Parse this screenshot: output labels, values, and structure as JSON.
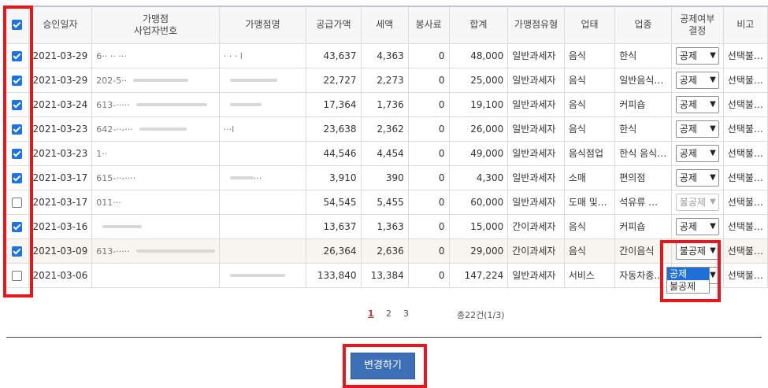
{
  "table": {
    "headers": {
      "approval_date": "승인일자",
      "merchant_bizno": "가맹점\n사업자번호",
      "merchant_name": "가맹점명",
      "supply_amount": "공급가액",
      "tax": "세액",
      "service_fee": "봉사료",
      "total": "합계",
      "merchant_type": "가맹점유형",
      "business_type": "업태",
      "business_item": "업종",
      "deduction": "공제여부\n결정",
      "note": "비고"
    },
    "rows": [
      {
        "checked": true,
        "date": "2021-03-29",
        "bizno": "6·· ·· ···",
        "name": "· · · l",
        "supply": "43,637",
        "tax": "4,363",
        "fee": "0",
        "total": "48,000",
        "type": "일반과세자",
        "biz": "음식",
        "item": "한식",
        "deduct": "공제",
        "deduct_disabled": false,
        "note": "선택불…"
      },
      {
        "checked": true,
        "date": "2021-03-29",
        "bizno": "202-5··",
        "name": "",
        "supply": "22,727",
        "tax": "2,273",
        "fee": "0",
        "total": "25,000",
        "type": "일반과세자",
        "biz": "음식",
        "item": "일반음식…",
        "deduct": "공제",
        "deduct_disabled": false,
        "note": "선택불…"
      },
      {
        "checked": true,
        "date": "2021-03-24",
        "bizno": "613-·····",
        "name": "",
        "supply": "17,364",
        "tax": "1,736",
        "fee": "0",
        "total": "19,100",
        "type": "일반과세자",
        "biz": "음식",
        "item": "커피숍",
        "deduct": "공제",
        "deduct_disabled": false,
        "note": "선택불…"
      },
      {
        "checked": true,
        "date": "2021-03-23",
        "bizno": "642-··-···",
        "name": "···l",
        "supply": "23,638",
        "tax": "2,362",
        "fee": "0",
        "total": "26,000",
        "type": "일반과세자",
        "biz": "음식",
        "item": "한식",
        "deduct": "공제",
        "deduct_disabled": false,
        "note": "선택불…"
      },
      {
        "checked": true,
        "date": "2021-03-23",
        "bizno": "1··",
        "name": "",
        "supply": "44,546",
        "tax": "4,454",
        "fee": "0",
        "total": "49,000",
        "type": "일반과세자",
        "biz": "음식점업",
        "item": "한식 음식…",
        "deduct": "공제",
        "deduct_disabled": false,
        "note": "선택불…"
      },
      {
        "checked": true,
        "date": "2021-03-17",
        "bizno": "615-··-····",
        "name": "···",
        "supply": "3,910",
        "tax": "390",
        "fee": "0",
        "total": "4,300",
        "type": "일반과세자",
        "biz": "소매",
        "item": "편의점",
        "deduct": "공제",
        "deduct_disabled": false,
        "note": "선택불…"
      },
      {
        "checked": false,
        "date": "2021-03-17",
        "bizno": "011···",
        "name": "",
        "supply": "54,545",
        "tax": "5,455",
        "fee": "0",
        "total": "60,000",
        "type": "일반과세자",
        "biz": "도매  및…",
        "item": "석유류  …",
        "deduct": "불공제",
        "deduct_disabled": true,
        "note": "선택불…"
      },
      {
        "checked": true,
        "date": "2021-03-16",
        "bizno": "",
        "name": "",
        "supply": "13,637",
        "tax": "1,363",
        "fee": "0",
        "total": "15,000",
        "type": "간이과세자",
        "biz": "음식",
        "item": "커피숍",
        "deduct": "공제",
        "deduct_disabled": false,
        "note": "선택불…"
      },
      {
        "checked": true,
        "date": "2021-03-09",
        "bizno": "613-·····",
        "name": "",
        "supply": "26,364",
        "tax": "2,636",
        "fee": "0",
        "total": "29,000",
        "type": "간이과세자",
        "biz": "음식",
        "item": "간이음식",
        "deduct": "불공제",
        "deduct_disabled": false,
        "note": "선택불…"
      },
      {
        "checked": false,
        "date": "2021-03-06",
        "bizno": "",
        "name": "",
        "supply": "133,840",
        "tax": "13,384",
        "fee": "0",
        "total": "147,224",
        "type": "일반과세자",
        "biz": "서비스",
        "item": "자동차종…",
        "deduct": "공제",
        "deduct_disabled": false,
        "note": "선택불…"
      }
    ]
  },
  "dropdown": {
    "options": [
      "공제",
      "불공제"
    ],
    "highlighted": "공제"
  },
  "pagination": {
    "pages": [
      "1",
      "2",
      "3"
    ],
    "current": "1",
    "total": "총22건(1/3)"
  },
  "submit_button": "변경하기",
  "highlight_color": "#e8151b",
  "accent_color": "#1a73e8"
}
